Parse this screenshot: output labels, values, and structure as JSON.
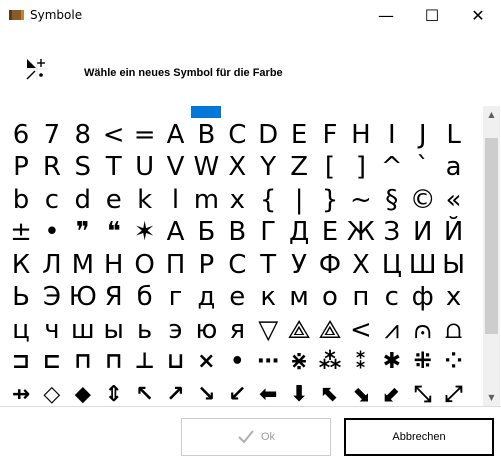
{
  "window": {
    "title": "Symbole",
    "minimize_glyph": "—",
    "maximize_glyph": "☐",
    "close_glyph": "✕"
  },
  "header": {
    "instruction": "Wähle ein neues Symbol für die Farbe",
    "icon": "symbol-picker-icon"
  },
  "symbols": {
    "selected_index": 6,
    "rows": [
      [
        "",
        "",
        "",
        "",
        "",
        "",
        "",
        "",
        "",
        "",
        "",
        "",
        "",
        "",
        "",
        ""
      ],
      [
        "6",
        "7",
        "8",
        "<",
        "=",
        "A",
        "B",
        "C",
        "D",
        "E",
        "F",
        "H",
        "I",
        "J",
        "L"
      ],
      [
        "P",
        "R",
        "S",
        "T",
        "U",
        "V",
        "W",
        "X",
        "Y",
        "Z",
        "[",
        "]",
        "^",
        "`",
        "a"
      ],
      [
        "b",
        "c",
        "d",
        "e",
        "k",
        "l",
        "m",
        "x",
        "{",
        "|",
        "}",
        "~",
        "§",
        "©",
        "«"
      ],
      [
        "±",
        "•",
        "❞",
        "❝",
        "✶",
        "А",
        "Б",
        "В",
        "Г",
        "Д",
        "Е",
        "Ж",
        "З",
        "И",
        "Й"
      ],
      [
        "К",
        "Л",
        "М",
        "Н",
        "О",
        "П",
        "Р",
        "С",
        "Т",
        "У",
        "Ф",
        "Х",
        "Ц",
        "Ш",
        "Ы"
      ],
      [
        "Ь",
        "Э",
        "Ю",
        "Я",
        "б",
        "г",
        "д",
        "е",
        "к",
        "м",
        "о",
        "п",
        "с",
        "ф",
        "х"
      ],
      [
        "ц",
        "ч",
        "ш",
        "ы",
        "ь",
        "э",
        "ю",
        "я",
        "▽",
        "⟁",
        "⟁",
        "<",
        "⩘",
        "⩀",
        "⩍"
      ],
      [
        "⊐",
        "⊏",
        "⊓",
        "⊓",
        "⊥",
        "⊔",
        "×",
        "•",
        "⋯",
        "⋇",
        "⁂",
        "⁑",
        "✱",
        "⁜",
        "⁘"
      ],
      [
        "⇸",
        "◇",
        "⬥",
        "⇕",
        "↖",
        "↗",
        "↘",
        "↙",
        "⬅",
        "⬇",
        "⬉",
        "⬊",
        "⬋",
        "⤡",
        "⤢"
      ]
    ]
  },
  "scrollbar": {
    "up_glyph": "▲",
    "down_glyph": "▼"
  },
  "buttons": {
    "ok_label": "Ok",
    "cancel_label": "Abbrechen"
  },
  "colors": {
    "selection": "#0078d7",
    "disabled_text": "#a0a0a0"
  }
}
